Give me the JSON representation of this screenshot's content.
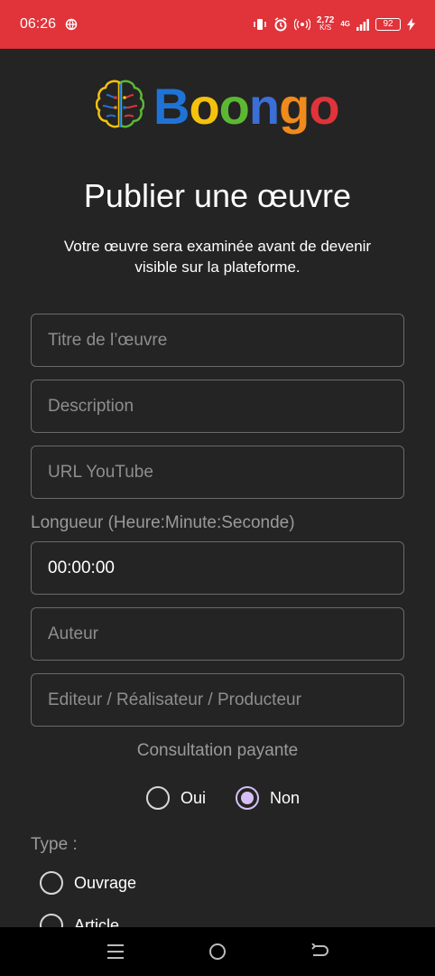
{
  "status_bar": {
    "time": "06:26",
    "speed_value": "2,72",
    "speed_unit": "K/S",
    "network": "4G",
    "battery": "92"
  },
  "logo": {
    "text_letters": [
      "B",
      "o",
      "o",
      "n",
      "g",
      "o"
    ],
    "colors": [
      "#1f73d6",
      "#f4c20d",
      "#5cb833",
      "#3b6fd8",
      "#f08a1c",
      "#e0333a"
    ]
  },
  "page": {
    "title": "Publier une œuvre",
    "subtitle": "Votre œuvre sera examinée avant de devenir visible sur la plateforme."
  },
  "form": {
    "title_placeholder": "Titre de l’œuvre",
    "description_placeholder": "Description",
    "youtube_placeholder": "URL YouTube",
    "length_label": "Longueur (Heure:Minute:Seconde)",
    "length_value": "00:00:00",
    "author_placeholder": "Auteur",
    "editor_placeholder": "Editeur / Réalisateur / Producteur",
    "paid_label": "Consultation payante",
    "paid_options": [
      "Oui",
      "Non"
    ],
    "paid_selected": "Non",
    "type_label": "Type :",
    "type_options": [
      "Ouvrage",
      "Article"
    ]
  },
  "accent_color": "#d6bff6",
  "status_bar_color": "#e0333a"
}
